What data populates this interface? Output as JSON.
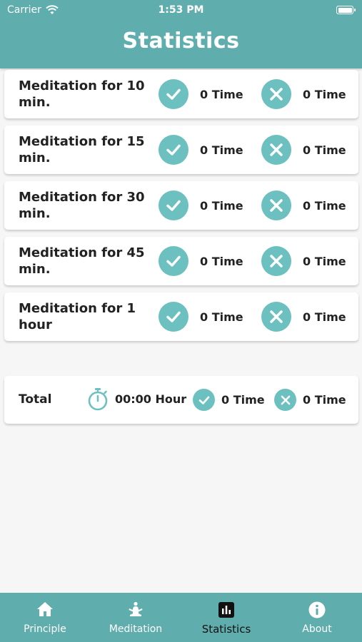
{
  "status_bar": {
    "carrier": "Carrier",
    "time": "1:53 PM"
  },
  "header": {
    "title": "Statistics"
  },
  "items": [
    {
      "label": "Meditation for 10 min.",
      "success": "0 Time",
      "fail": "0 Time"
    },
    {
      "label": "Meditation for 15 min.",
      "success": "0 Time",
      "fail": "0 Time"
    },
    {
      "label": "Meditation for 30 min.",
      "success": "0 Time",
      "fail": "0 Time"
    },
    {
      "label": "Meditation for 45 min.",
      "success": "0 Time",
      "fail": "0 Time"
    },
    {
      "label": "Meditation for 1 hour",
      "success": "0 Time",
      "fail": "0 Time"
    }
  ],
  "total": {
    "label": "Total",
    "duration": "00:00 Hour",
    "success": "0 Time",
    "fail": "0 Time"
  },
  "tabs": [
    {
      "label": "Principle",
      "icon": "home-icon"
    },
    {
      "label": "Meditation",
      "icon": "meditation-icon"
    },
    {
      "label": "Statistics",
      "icon": "bar-chart-icon"
    },
    {
      "label": "About",
      "icon": "info-icon"
    }
  ],
  "colors": {
    "accent": "#5fadad",
    "icon_circle": "#6cc0c0"
  }
}
